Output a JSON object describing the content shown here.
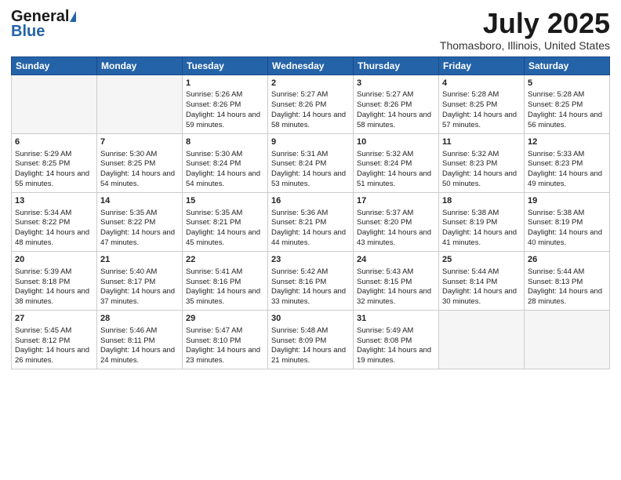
{
  "header": {
    "logo_general": "General",
    "logo_blue": "Blue",
    "month": "July 2025",
    "location": "Thomasboro, Illinois, United States"
  },
  "weekdays": [
    "Sunday",
    "Monday",
    "Tuesday",
    "Wednesday",
    "Thursday",
    "Friday",
    "Saturday"
  ],
  "weeks": [
    [
      {
        "day": "",
        "sunrise": "",
        "sunset": "",
        "daylight": ""
      },
      {
        "day": "",
        "sunrise": "",
        "sunset": "",
        "daylight": ""
      },
      {
        "day": "1",
        "sunrise": "Sunrise: 5:26 AM",
        "sunset": "Sunset: 8:26 PM",
        "daylight": "Daylight: 14 hours and 59 minutes."
      },
      {
        "day": "2",
        "sunrise": "Sunrise: 5:27 AM",
        "sunset": "Sunset: 8:26 PM",
        "daylight": "Daylight: 14 hours and 58 minutes."
      },
      {
        "day": "3",
        "sunrise": "Sunrise: 5:27 AM",
        "sunset": "Sunset: 8:26 PM",
        "daylight": "Daylight: 14 hours and 58 minutes."
      },
      {
        "day": "4",
        "sunrise": "Sunrise: 5:28 AM",
        "sunset": "Sunset: 8:25 PM",
        "daylight": "Daylight: 14 hours and 57 minutes."
      },
      {
        "day": "5",
        "sunrise": "Sunrise: 5:28 AM",
        "sunset": "Sunset: 8:25 PM",
        "daylight": "Daylight: 14 hours and 56 minutes."
      }
    ],
    [
      {
        "day": "6",
        "sunrise": "Sunrise: 5:29 AM",
        "sunset": "Sunset: 8:25 PM",
        "daylight": "Daylight: 14 hours and 55 minutes."
      },
      {
        "day": "7",
        "sunrise": "Sunrise: 5:30 AM",
        "sunset": "Sunset: 8:25 PM",
        "daylight": "Daylight: 14 hours and 54 minutes."
      },
      {
        "day": "8",
        "sunrise": "Sunrise: 5:30 AM",
        "sunset": "Sunset: 8:24 PM",
        "daylight": "Daylight: 14 hours and 54 minutes."
      },
      {
        "day": "9",
        "sunrise": "Sunrise: 5:31 AM",
        "sunset": "Sunset: 8:24 PM",
        "daylight": "Daylight: 14 hours and 53 minutes."
      },
      {
        "day": "10",
        "sunrise": "Sunrise: 5:32 AM",
        "sunset": "Sunset: 8:24 PM",
        "daylight": "Daylight: 14 hours and 51 minutes."
      },
      {
        "day": "11",
        "sunrise": "Sunrise: 5:32 AM",
        "sunset": "Sunset: 8:23 PM",
        "daylight": "Daylight: 14 hours and 50 minutes."
      },
      {
        "day": "12",
        "sunrise": "Sunrise: 5:33 AM",
        "sunset": "Sunset: 8:23 PM",
        "daylight": "Daylight: 14 hours and 49 minutes."
      }
    ],
    [
      {
        "day": "13",
        "sunrise": "Sunrise: 5:34 AM",
        "sunset": "Sunset: 8:22 PM",
        "daylight": "Daylight: 14 hours and 48 minutes."
      },
      {
        "day": "14",
        "sunrise": "Sunrise: 5:35 AM",
        "sunset": "Sunset: 8:22 PM",
        "daylight": "Daylight: 14 hours and 47 minutes."
      },
      {
        "day": "15",
        "sunrise": "Sunrise: 5:35 AM",
        "sunset": "Sunset: 8:21 PM",
        "daylight": "Daylight: 14 hours and 45 minutes."
      },
      {
        "day": "16",
        "sunrise": "Sunrise: 5:36 AM",
        "sunset": "Sunset: 8:21 PM",
        "daylight": "Daylight: 14 hours and 44 minutes."
      },
      {
        "day": "17",
        "sunrise": "Sunrise: 5:37 AM",
        "sunset": "Sunset: 8:20 PM",
        "daylight": "Daylight: 14 hours and 43 minutes."
      },
      {
        "day": "18",
        "sunrise": "Sunrise: 5:38 AM",
        "sunset": "Sunset: 8:19 PM",
        "daylight": "Daylight: 14 hours and 41 minutes."
      },
      {
        "day": "19",
        "sunrise": "Sunrise: 5:38 AM",
        "sunset": "Sunset: 8:19 PM",
        "daylight": "Daylight: 14 hours and 40 minutes."
      }
    ],
    [
      {
        "day": "20",
        "sunrise": "Sunrise: 5:39 AM",
        "sunset": "Sunset: 8:18 PM",
        "daylight": "Daylight: 14 hours and 38 minutes."
      },
      {
        "day": "21",
        "sunrise": "Sunrise: 5:40 AM",
        "sunset": "Sunset: 8:17 PM",
        "daylight": "Daylight: 14 hours and 37 minutes."
      },
      {
        "day": "22",
        "sunrise": "Sunrise: 5:41 AM",
        "sunset": "Sunset: 8:16 PM",
        "daylight": "Daylight: 14 hours and 35 minutes."
      },
      {
        "day": "23",
        "sunrise": "Sunrise: 5:42 AM",
        "sunset": "Sunset: 8:16 PM",
        "daylight": "Daylight: 14 hours and 33 minutes."
      },
      {
        "day": "24",
        "sunrise": "Sunrise: 5:43 AM",
        "sunset": "Sunset: 8:15 PM",
        "daylight": "Daylight: 14 hours and 32 minutes."
      },
      {
        "day": "25",
        "sunrise": "Sunrise: 5:44 AM",
        "sunset": "Sunset: 8:14 PM",
        "daylight": "Daylight: 14 hours and 30 minutes."
      },
      {
        "day": "26",
        "sunrise": "Sunrise: 5:44 AM",
        "sunset": "Sunset: 8:13 PM",
        "daylight": "Daylight: 14 hours and 28 minutes."
      }
    ],
    [
      {
        "day": "27",
        "sunrise": "Sunrise: 5:45 AM",
        "sunset": "Sunset: 8:12 PM",
        "daylight": "Daylight: 14 hours and 26 minutes."
      },
      {
        "day": "28",
        "sunrise": "Sunrise: 5:46 AM",
        "sunset": "Sunset: 8:11 PM",
        "daylight": "Daylight: 14 hours and 24 minutes."
      },
      {
        "day": "29",
        "sunrise": "Sunrise: 5:47 AM",
        "sunset": "Sunset: 8:10 PM",
        "daylight": "Daylight: 14 hours and 23 minutes."
      },
      {
        "day": "30",
        "sunrise": "Sunrise: 5:48 AM",
        "sunset": "Sunset: 8:09 PM",
        "daylight": "Daylight: 14 hours and 21 minutes."
      },
      {
        "day": "31",
        "sunrise": "Sunrise: 5:49 AM",
        "sunset": "Sunset: 8:08 PM",
        "daylight": "Daylight: 14 hours and 19 minutes."
      },
      {
        "day": "",
        "sunrise": "",
        "sunset": "",
        "daylight": ""
      },
      {
        "day": "",
        "sunrise": "",
        "sunset": "",
        "daylight": ""
      }
    ]
  ]
}
